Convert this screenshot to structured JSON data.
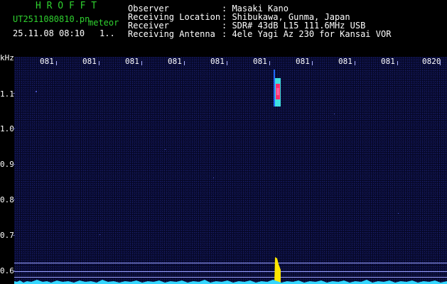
{
  "header": {
    "logo": "H R O F F T",
    "file_name": "UT2511080810.pn",
    "mode": "meteor",
    "timestamp": "25.11.08 08:10",
    "page": "1.."
  },
  "info": {
    "observer": {
      "key": "Observer",
      "value": ": Masaki Kano"
    },
    "location": {
      "key": "Receiving Location",
      "value": ": Shibukawa, Gunma, Japan"
    },
    "receiver": {
      "key": "Receiver",
      "value": ": SDR# 43dB L15 111.6MHz USB"
    },
    "antenna": {
      "key": "Receiving Antenna",
      "value": ": 4ele Yagi Az 230 for Kansai VOR"
    }
  },
  "axes": {
    "unit": "kHz",
    "time_labels": [
      "081",
      "081",
      "081",
      "081",
      "081",
      "081",
      "081",
      "081",
      "081",
      "0820"
    ],
    "freq_labels": [
      "1.1",
      "1.0",
      "0.9",
      "0.8",
      "0.7",
      "0.6"
    ]
  },
  "colors": {
    "background": "#000000",
    "plot_background": "#060828",
    "header_accent": "#2fd12f",
    "meteor_core": "#ff2a6a",
    "meteor_halo": "#3fe0e0",
    "carrier": "#ffe600",
    "noise_baseline": "#33d6ff"
  }
}
